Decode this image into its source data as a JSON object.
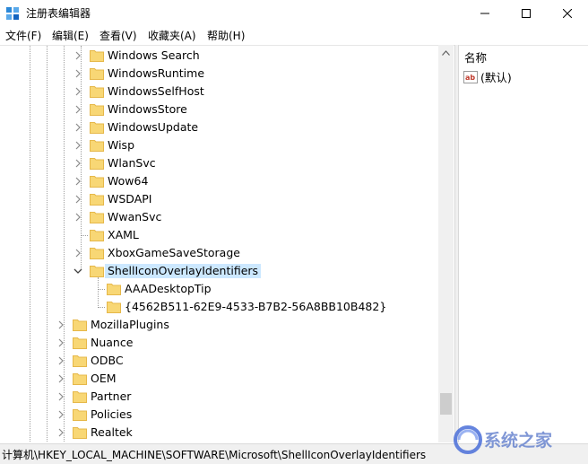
{
  "window": {
    "title": "注册表编辑器",
    "minimize_icon": "minimize-icon",
    "maximize_icon": "maximize-icon",
    "close_icon": "close-icon"
  },
  "menu": [
    "文件(F)",
    "编辑(E)",
    "查看(V)",
    "收藏夹(A)",
    "帮助(H)"
  ],
  "tree": {
    "items": [
      {
        "label": "Windows Search",
        "level": 2,
        "expander": "collapsed"
      },
      {
        "label": "WindowsRuntime",
        "level": 2,
        "expander": "collapsed"
      },
      {
        "label": "WindowsSelfHost",
        "level": 2,
        "expander": "collapsed"
      },
      {
        "label": "WindowsStore",
        "level": 2,
        "expander": "collapsed"
      },
      {
        "label": "WindowsUpdate",
        "level": 2,
        "expander": "collapsed"
      },
      {
        "label": "Wisp",
        "level": 2,
        "expander": "collapsed"
      },
      {
        "label": "WlanSvc",
        "level": 2,
        "expander": "collapsed"
      },
      {
        "label": "Wow64",
        "level": 2,
        "expander": "collapsed"
      },
      {
        "label": "WSDAPI",
        "level": 2,
        "expander": "collapsed"
      },
      {
        "label": "WwanSvc",
        "level": 2,
        "expander": "collapsed"
      },
      {
        "label": "XAML",
        "level": 2,
        "expander": "none"
      },
      {
        "label": "XboxGameSaveStorage",
        "level": 2,
        "expander": "collapsed"
      },
      {
        "label": "ShellIconOverlayIdentifiers",
        "level": 2,
        "expander": "expanded",
        "selected": true
      },
      {
        "label": "AAADesktopTip",
        "level": 3,
        "expander": "none"
      },
      {
        "label": "{4562B511-62E9-4533-B7B2-56A8BB10B482}",
        "level": 3,
        "expander": "none"
      },
      {
        "label": "MozillaPlugins",
        "level": 1,
        "expander": "collapsed"
      },
      {
        "label": "Nuance",
        "level": 1,
        "expander": "collapsed"
      },
      {
        "label": "ODBC",
        "level": 1,
        "expander": "collapsed"
      },
      {
        "label": "OEM",
        "level": 1,
        "expander": "collapsed"
      },
      {
        "label": "Partner",
        "level": 1,
        "expander": "collapsed"
      },
      {
        "label": "Policies",
        "level": 1,
        "expander": "collapsed"
      },
      {
        "label": "Realtek",
        "level": 1,
        "expander": "collapsed"
      }
    ]
  },
  "list": {
    "column_name": "名称",
    "values": [
      {
        "name": "(默认)",
        "icon": "string-value-icon",
        "icon_text": "ab"
      }
    ]
  },
  "status": {
    "path": "计算机\\HKEY_LOCAL_MACHINE\\SOFTWARE\\Microsoft\\ShellIconOverlayIdentifiers"
  },
  "watermark": {
    "text": "系统之家"
  },
  "colors": {
    "folder": "#f8d775",
    "folder_dark": "#e6b84a",
    "selection": "#cce8ff",
    "accent": "#0078d7"
  }
}
